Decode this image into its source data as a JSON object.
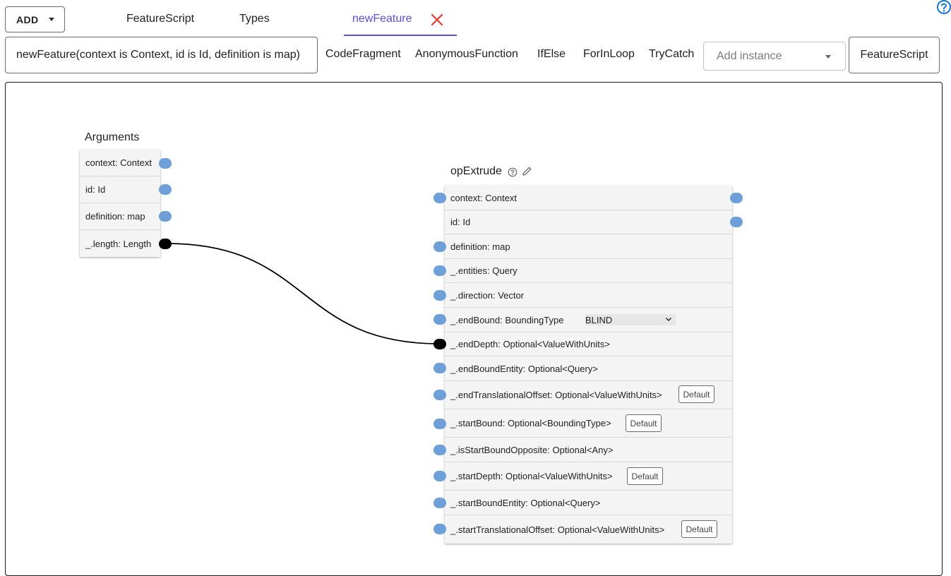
{
  "toolbar": {
    "add_label": "ADD",
    "tabs": [
      {
        "label": "FeatureScript"
      },
      {
        "label": "Types"
      },
      {
        "label": "newFeature"
      }
    ]
  },
  "editor": {
    "signature": "newFeature(context is Context, id is Id, definition is map)",
    "snippets": [
      "CodeFragment",
      "AnonymousFunction",
      "IfElse",
      "ForInLoop",
      "TryCatch"
    ],
    "add_instance_placeholder": "Add instance",
    "featurescript_button": "FeatureScript"
  },
  "arguments_node": {
    "title": "Arguments",
    "rows": [
      {
        "label": "context: Context"
      },
      {
        "label": "id: Id"
      },
      {
        "label": "definition: map"
      },
      {
        "label": "_.length: Length"
      }
    ]
  },
  "op_node": {
    "title": "opExtrude",
    "rows": [
      {
        "label": "context: Context"
      },
      {
        "label": "id: Id"
      },
      {
        "label": "definition: map"
      },
      {
        "label": "_.entities: Query"
      },
      {
        "label": "_.direction: Vector"
      },
      {
        "label": "_.endBound: BoundingType",
        "select_value": "BLIND"
      },
      {
        "label": "_.endDepth: Optional<ValueWithUnits>"
      },
      {
        "label": "_.endBoundEntity: Optional<Query>"
      },
      {
        "label": "_.endTranslationalOffset: Optional<ValueWithUnits>",
        "button": "Default"
      },
      {
        "label": "_.startBound: Optional<BoundingType>",
        "button": "Default"
      },
      {
        "label": "_.isStartBoundOpposite: Optional<Any>"
      },
      {
        "label": "_.startDepth: Optional<ValueWithUnits>",
        "button": "Default"
      },
      {
        "label": "_.startBoundEntity: Optional<Query>"
      },
      {
        "label": "_.startTranslationalOffset: Optional<ValueWithUnits>",
        "button": "Default"
      }
    ]
  },
  "colors": {
    "accent": "#5b4fd6",
    "close": "#e53935",
    "help": "#1976d2",
    "port": "#6f9fd8",
    "connected_port": "#000000"
  }
}
